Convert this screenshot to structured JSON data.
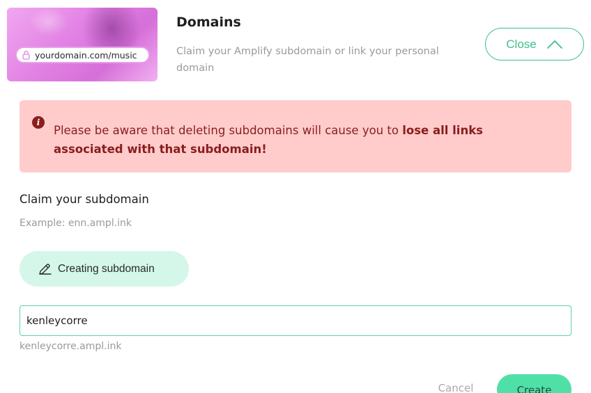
{
  "hero": {
    "url_chip": "yourdomain.com/music",
    "icon": "lock-icon"
  },
  "header": {
    "title": "Domains",
    "description": "Claim your Amplify subdomain or link your personal domain",
    "close_label": "Close",
    "close_icon": "chevron-up-icon"
  },
  "alert": {
    "icon": "info-icon",
    "icon_glyph": "i",
    "text_normal": "Please be aware that deleting subdomains will cause you to ",
    "text_bold": "lose all links associated with that subdomain!"
  },
  "claim": {
    "title": "Claim your subdomain",
    "example": "Example: enn.ampl.ink",
    "creating_label": "Creating subdomain",
    "creating_icon": "pencil-icon",
    "input_value": "kenleycorre",
    "preview": "kenleycorre.ampl.ink"
  },
  "actions": {
    "cancel_label": "Cancel",
    "create_label": "Create"
  },
  "colors": {
    "accent": "#3dbf8a",
    "alert_bg": "#ffcccb",
    "alert_text": "#8a1d1d",
    "create_bg": "#4fe0a8",
    "creating_bg": "#d4f7e9"
  }
}
